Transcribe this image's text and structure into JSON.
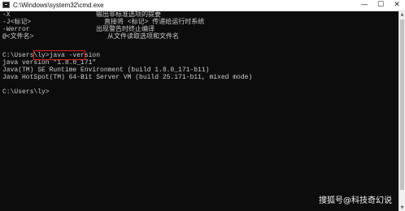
{
  "window": {
    "title": "C:\\Windows\\system32\\cmd.exe",
    "controls": {
      "minimize": "—",
      "maximize": "☐",
      "close": "✕"
    }
  },
  "console": {
    "help_options": [
      {
        "option": "-X",
        "description": "输出非标准选项的提要"
      },
      {
        "option": "-J<标记>",
        "description": "直接将 <标记> 传递给运行时系统"
      },
      {
        "option": "-Werror",
        "description": "出现警告时终止编译"
      },
      {
        "option": "@<文件名>",
        "description": "从文件读取选项和文件名"
      }
    ],
    "prompt1": "C:\\Users\\ly>",
    "command": "java -version",
    "output": [
      "java version \"1.8.0_171\"",
      "Java(TM) SE Runtime Environment (build 1.8.0_171-b11)",
      "Java HotSpot(TM) 64-Bit Server VM (build 25.171-b11, mixed mode)"
    ],
    "prompt2": "C:\\Users\\ly>"
  },
  "scrollbar": {
    "up_arrow": "▲",
    "down_arrow": "▼"
  },
  "watermark": "搜狐号@科技奇幻说",
  "colors": {
    "background": "#0c0c0c",
    "text": "#cccccc",
    "highlight_border": "#e0201b"
  }
}
